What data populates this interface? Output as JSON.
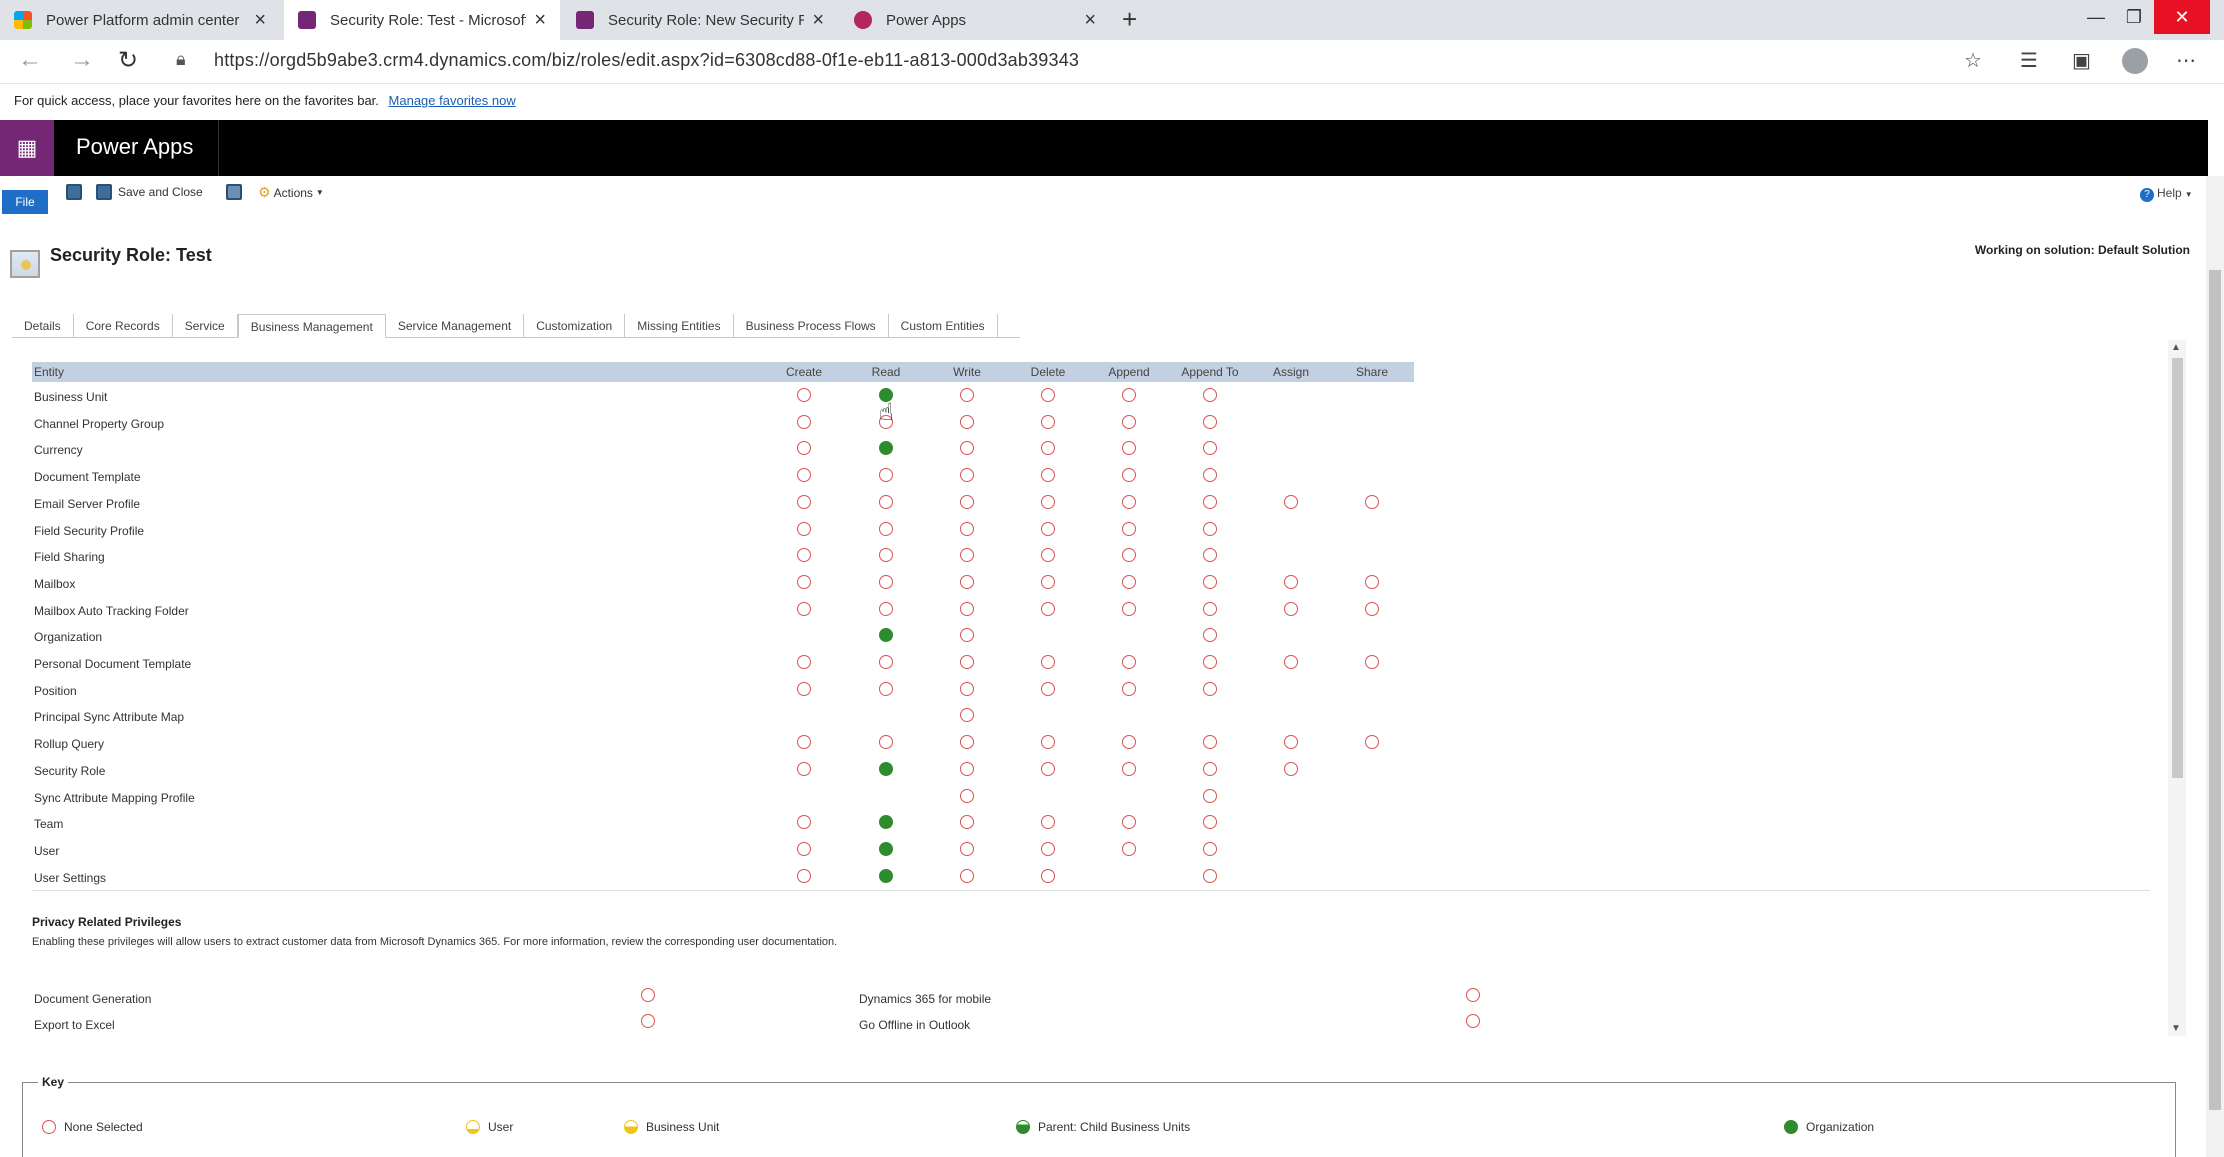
{
  "browser": {
    "tabs": [
      {
        "title": "Power Platform admin center",
        "favicon": "ms-logo-icon"
      },
      {
        "title": "Security Role: Test - Microsoft D",
        "favicon": "powerapps-icon"
      },
      {
        "title": "Security Role: New Security Role",
        "favicon": "powerapps-icon"
      },
      {
        "title": "Power Apps",
        "favicon": "powerapps-icon"
      }
    ],
    "active_tab": 1,
    "url": "https://orgd5b9abe3.crm4.dynamics.com/biz/roles/edit.aspx?id=6308cd88-0f1e-eb11-a813-000d3ab39343",
    "favorites_bar": {
      "text": "For quick access, place your favorites here on the favorites bar.",
      "link": "Manage favorites now"
    }
  },
  "app": {
    "name": "Power Apps"
  },
  "ribbon": {
    "file": "File",
    "save_close": "Save and Close",
    "actions": "Actions",
    "help": "Help"
  },
  "page": {
    "title": "Security Role: Test",
    "solution": "Working on solution: Default Solution"
  },
  "tabs": [
    "Details",
    "Core Records",
    "Service",
    "Business Management",
    "Service Management",
    "Customization",
    "Missing Entities",
    "Business Process Flows",
    "Custom Entities"
  ],
  "selected_tab": 3,
  "grid": {
    "columns": [
      "Entity",
      "Create",
      "Read",
      "Write",
      "Delete",
      "Append",
      "Append To",
      "Assign",
      "Share"
    ],
    "legend_codes": {
      "n": "None Selected",
      "o": "Organization",
      "": "not applicable"
    },
    "rows": [
      {
        "entity": "Business Unit",
        "privs": [
          "n",
          "o",
          "n",
          "n",
          "n",
          "n",
          "",
          ""
        ]
      },
      {
        "entity": "Channel Property Group",
        "privs": [
          "n",
          "n",
          "n",
          "n",
          "n",
          "n",
          "",
          ""
        ]
      },
      {
        "entity": "Currency",
        "privs": [
          "n",
          "o",
          "n",
          "n",
          "n",
          "n",
          "",
          ""
        ]
      },
      {
        "entity": "Document Template",
        "privs": [
          "n",
          "n",
          "n",
          "n",
          "n",
          "n",
          "",
          ""
        ]
      },
      {
        "entity": "Email Server Profile",
        "privs": [
          "n",
          "n",
          "n",
          "n",
          "n",
          "n",
          "n",
          "n"
        ]
      },
      {
        "entity": "Field Security Profile",
        "privs": [
          "n",
          "n",
          "n",
          "n",
          "n",
          "n",
          "",
          ""
        ]
      },
      {
        "entity": "Field Sharing",
        "privs": [
          "n",
          "n",
          "n",
          "n",
          "n",
          "n",
          "",
          ""
        ]
      },
      {
        "entity": "Mailbox",
        "privs": [
          "n",
          "n",
          "n",
          "n",
          "n",
          "n",
          "n",
          "n"
        ]
      },
      {
        "entity": "Mailbox Auto Tracking Folder",
        "privs": [
          "n",
          "n",
          "n",
          "n",
          "n",
          "n",
          "n",
          "n"
        ]
      },
      {
        "entity": "Organization",
        "privs": [
          "",
          "o",
          "n",
          "",
          "",
          "n",
          "",
          ""
        ]
      },
      {
        "entity": "Personal Document Template",
        "privs": [
          "n",
          "n",
          "n",
          "n",
          "n",
          "n",
          "n",
          "n"
        ]
      },
      {
        "entity": "Position",
        "privs": [
          "n",
          "n",
          "n",
          "n",
          "n",
          "n",
          "",
          ""
        ]
      },
      {
        "entity": "Principal Sync Attribute Map",
        "privs": [
          "",
          "",
          "n",
          "",
          "",
          "",
          "",
          ""
        ]
      },
      {
        "entity": "Rollup Query",
        "privs": [
          "n",
          "n",
          "n",
          "n",
          "n",
          "n",
          "n",
          "n"
        ]
      },
      {
        "entity": "Security Role",
        "privs": [
          "n",
          "o",
          "n",
          "n",
          "n",
          "n",
          "n",
          ""
        ]
      },
      {
        "entity": "Sync Attribute Mapping Profile",
        "privs": [
          "",
          "",
          "n",
          "",
          "",
          "n",
          "",
          ""
        ]
      },
      {
        "entity": "Team",
        "privs": [
          "n",
          "o",
          "n",
          "n",
          "n",
          "n",
          "",
          ""
        ]
      },
      {
        "entity": "User",
        "privs": [
          "n",
          "o",
          "n",
          "n",
          "n",
          "n",
          "",
          ""
        ]
      },
      {
        "entity": "User Settings",
        "privs": [
          "n",
          "o",
          "n",
          "n",
          "",
          "n",
          "",
          ""
        ]
      }
    ]
  },
  "privacy": {
    "title": "Privacy Related Privileges",
    "description": "Enabling these privileges will allow users to extract customer data from Microsoft Dynamics 365. For more information, review the corresponding user documentation.",
    "left": [
      {
        "label": "Document Generation",
        "value": "n"
      },
      {
        "label": "Export to Excel",
        "value": "n"
      }
    ],
    "right": [
      {
        "label": "Dynamics 365 for mobile",
        "value": "n"
      },
      {
        "label": "Go Offline in Outlook",
        "value": "n"
      }
    ]
  },
  "key": {
    "title": "Key",
    "items": [
      "None Selected",
      "User",
      "Business Unit",
      "Parent: Child Business Units",
      "Organization"
    ]
  },
  "colors": {
    "none_selected": "#d9534f",
    "organization": "#2e8b2e",
    "user": "#f0c419",
    "header_row": "#c3d0e1",
    "app_accent": "#742774",
    "file_button": "#1e6ec7"
  }
}
